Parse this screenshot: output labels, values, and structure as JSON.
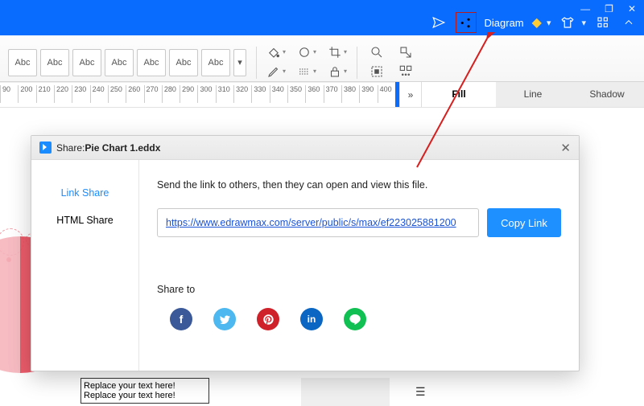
{
  "titlebar": {
    "diagram_label": "Diagram",
    "sys": {
      "min": "—",
      "restore": "❐",
      "close": "✕"
    }
  },
  "ribbon": {
    "abc_label": "Abc"
  },
  "ruler": {
    "ticks": [
      "90",
      "200",
      "210",
      "220",
      "230",
      "240",
      "250",
      "260",
      "270",
      "280",
      "290",
      "300",
      "310",
      "320",
      "330",
      "340",
      "350",
      "360",
      "370",
      "380",
      "390",
      "400"
    ]
  },
  "side_panel": {
    "collapse_glyph": "»",
    "tabs": {
      "fill": "Fill",
      "line": "Line",
      "shadow": "Shadow"
    }
  },
  "canvas": {
    "placeholder_line": "Replace your text here!"
  },
  "modal": {
    "title_prefix": "Share: ",
    "title_file": "Pie Chart 1.eddx",
    "close_glyph": "✕",
    "left": {
      "link_share": "Link Share",
      "html_share": "HTML Share"
    },
    "instruction": "Send the link to others, then they can open and view this file.",
    "link_url": "https://www.edrawmax.com/server/public/s/max/ef223025881200",
    "copy_label": "Copy Link",
    "share_to_label": "Share to",
    "social": {
      "fb": "f",
      "tw": "",
      "pin": "",
      "in": "in",
      "line": ""
    }
  }
}
